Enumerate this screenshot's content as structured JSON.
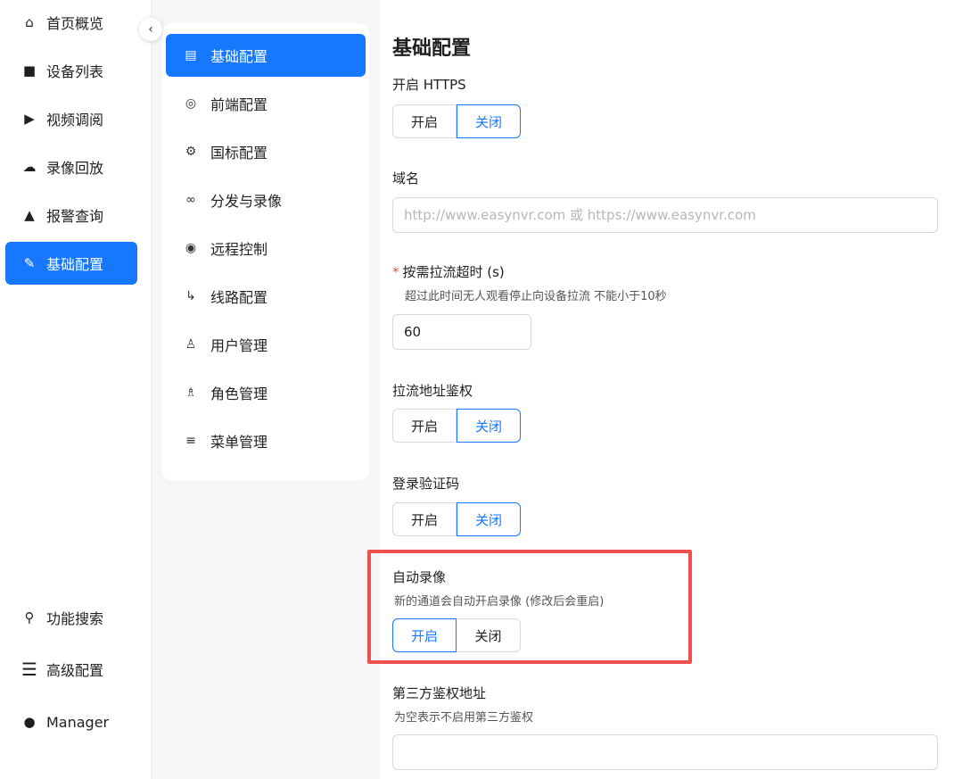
{
  "sidebar": {
    "items": [
      {
        "label": "首页概览",
        "icon": "home-icon",
        "glyph": "⌂"
      },
      {
        "label": "设备列表",
        "icon": "camera-icon",
        "glyph": "■"
      },
      {
        "label": "视频调阅",
        "icon": "play-icon",
        "glyph": "▶"
      },
      {
        "label": "录像回放",
        "icon": "cloud-icon",
        "glyph": "☁"
      },
      {
        "label": "报警查询",
        "icon": "alarm-icon",
        "glyph": "▲"
      },
      {
        "label": "基础配置",
        "icon": "edit-icon",
        "glyph": "✎"
      }
    ],
    "bottom": [
      {
        "label": "功能搜索",
        "icon": "search-icon",
        "glyph": "⚲"
      },
      {
        "label": "高级配置",
        "icon": "menu-icon",
        "glyph": "☰"
      },
      {
        "label": "Manager",
        "icon": "user-icon",
        "glyph": "●"
      }
    ],
    "collapse_glyph": "‹"
  },
  "submenu": {
    "items": [
      {
        "label": "基础配置",
        "icon": "document-icon",
        "glyph": "▤"
      },
      {
        "label": "前端配置",
        "icon": "chrome-icon",
        "glyph": "◎"
      },
      {
        "label": "国标配置",
        "icon": "gear-icon",
        "glyph": "⚙"
      },
      {
        "label": "分发与录像",
        "icon": "share-icon",
        "glyph": "∞"
      },
      {
        "label": "远程控制",
        "icon": "remote-icon",
        "glyph": "◉"
      },
      {
        "label": "线路配置",
        "icon": "route-icon",
        "glyph": "↳"
      },
      {
        "label": "用户管理",
        "icon": "users-icon",
        "glyph": "♙"
      },
      {
        "label": "角色管理",
        "icon": "role-icon",
        "glyph": "♗"
      },
      {
        "label": "菜单管理",
        "icon": "list-icon",
        "glyph": "≡"
      }
    ]
  },
  "form": {
    "title": "基础配置",
    "https": {
      "label": "开启 HTTPS",
      "on": "开启",
      "off": "关闭",
      "value": "关闭"
    },
    "domain": {
      "label": "域名",
      "placeholder": "http://www.easynvr.com 或 https://www.easynvr.com",
      "value": ""
    },
    "timeout": {
      "required_mark": "*",
      "label": "按需拉流超时 (s)",
      "desc": "超过此时间无人观看停止向设备拉流 不能小于10秒",
      "value": "60"
    },
    "pull_auth": {
      "label": "拉流地址鉴权",
      "on": "开启",
      "off": "关闭",
      "value": "关闭"
    },
    "captcha": {
      "label": "登录验证码",
      "on": "开启",
      "off": "关闭",
      "value": "关闭"
    },
    "auto_record": {
      "label": "自动录像",
      "desc": "新的通道会自动开启录像 (修改后会重启)",
      "on": "开启",
      "off": "关闭",
      "value": "开启"
    },
    "third_auth": {
      "label": "第三方鉴权地址",
      "desc": "为空表示不启用第三方鉴权",
      "value": ""
    }
  },
  "colors": {
    "accent": "#1677ff",
    "highlight": "#ee5050",
    "required": "#ff4d4f"
  }
}
